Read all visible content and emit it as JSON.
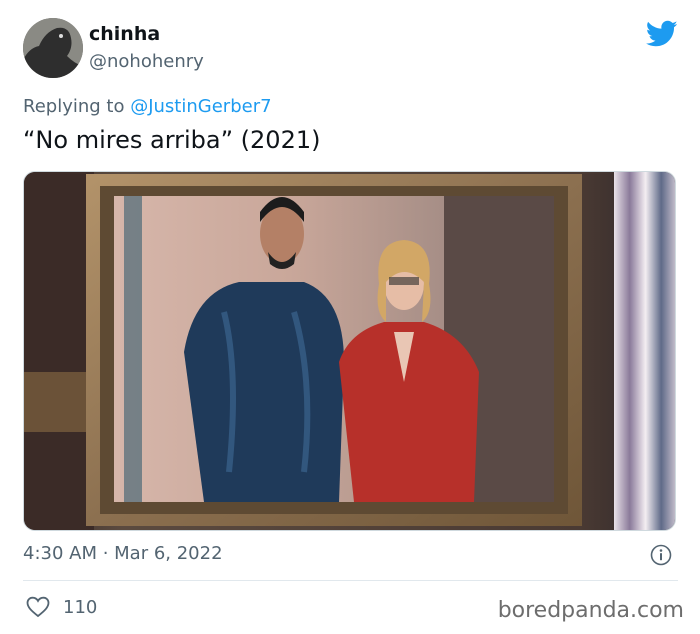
{
  "tweet": {
    "author_name": "chinha",
    "author_handle": "@nohohenry",
    "reply_prefix": "Replying to ",
    "reply_handle": "@JustinGerber7",
    "text": "“No mires arriba” (2021)",
    "timestamp": "4:30 AM · Mar 6, 2022",
    "like_count": "110"
  },
  "icons": {
    "brand": "twitter-bird-icon",
    "info": "info-icon",
    "like": "heart-icon"
  },
  "colors": {
    "brand_blue": "#1d9bf0",
    "secondary_text": "#536471"
  },
  "watermark": "boredpanda.com"
}
